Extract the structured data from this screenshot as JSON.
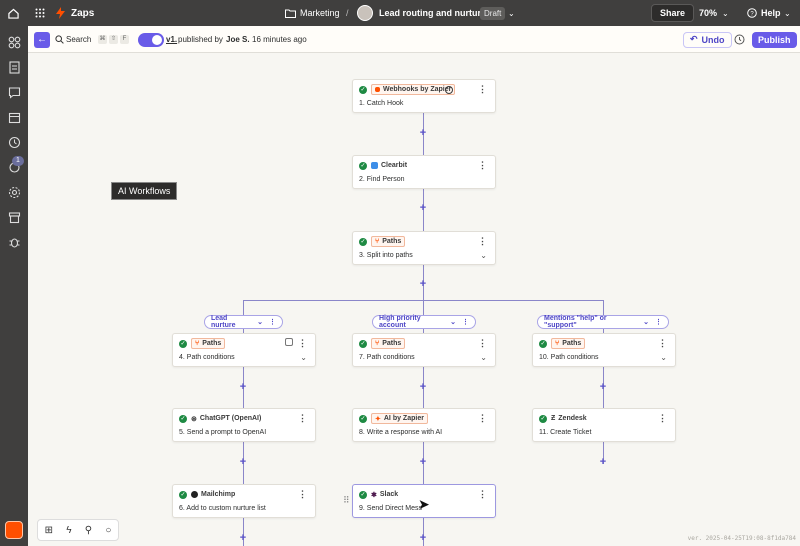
{
  "topbar": {
    "app_name": "Zaps",
    "folder": "Marketing",
    "separator": "/",
    "zap_title": "Lead routing and nurture",
    "status": "Draft",
    "share_label": "Share",
    "zoom": "70%",
    "help_label": "Help"
  },
  "toolbar": {
    "search_label": "Search",
    "shortcut_keys": [
      "⌘",
      "⇧",
      "F"
    ],
    "version_link": "v1.",
    "published_prefix": "published by",
    "published_by": "Joe S.",
    "published_time": "16 minutes ago",
    "undo_label": "Undo",
    "publish_label": "Publish"
  },
  "rail": {
    "badge_count": "1"
  },
  "canvas": {
    "ai_workflows_label": "AI Workflows",
    "steps": [
      {
        "app": "Webhooks by Zapier",
        "step": "1. Catch Hook",
        "boxed": true
      },
      {
        "app": "Clearbit",
        "step": "2. Find Person",
        "boxed": false
      },
      {
        "app": "Paths",
        "step": "3. Split into paths",
        "boxed": true
      }
    ],
    "paths": [
      {
        "label": "Lead nurture",
        "steps": [
          {
            "app": "Paths",
            "step": "4. Path conditions",
            "boxed": true
          },
          {
            "app": "ChatGPT (OpenAI)",
            "step": "5. Send a prompt to OpenAI",
            "boxed": false
          },
          {
            "app": "Mailchimp",
            "step": "6. Add to custom nurture list",
            "boxed": false
          }
        ]
      },
      {
        "label": "High priority account",
        "steps": [
          {
            "app": "Paths",
            "step": "7. Path conditions",
            "boxed": true
          },
          {
            "app": "AI by Zapier",
            "step": "8. Write a response with AI",
            "boxed": true
          },
          {
            "app": "Slack",
            "step": "9. Send Direct Mess",
            "boxed": false
          }
        ]
      },
      {
        "label": "Mentions \"help\" or \"support\"",
        "steps": [
          {
            "app": "Paths",
            "step": "10. Path conditions",
            "boxed": true
          },
          {
            "app": "Zendesk",
            "step": "11. Create Ticket",
            "boxed": false
          }
        ]
      }
    ],
    "version_text": "ver. 2025-04-25T19:08-8f1da784"
  },
  "colors": {
    "accent": "#695be8",
    "topbar_bg": "#403f3e",
    "success": "#1e8a43",
    "brand_orange": "#ff4f00"
  }
}
